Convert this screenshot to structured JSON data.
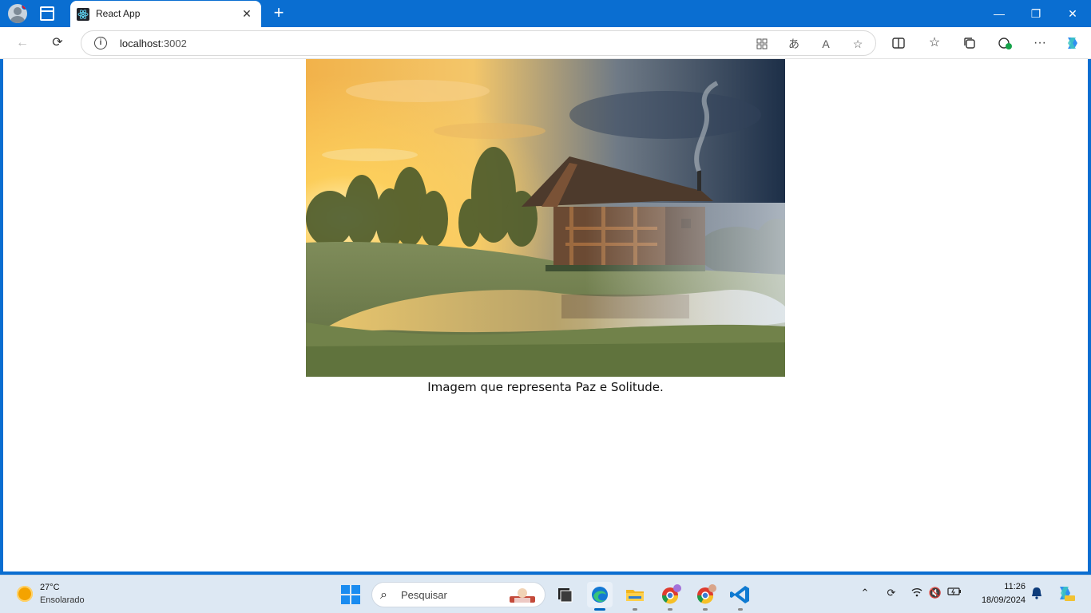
{
  "browser": {
    "tab_title": "React App",
    "tab_close": "✕",
    "new_tab": "+",
    "window_minimize": "—",
    "window_restore": "❐",
    "window_close": "✕",
    "nav_back": "←",
    "nav_refresh": "⟳",
    "url_host": "localhost",
    "url_port": ":3002",
    "url_icons": [
      "apps-icon",
      "translate-icon",
      "read-aloud-icon",
      "favorite-star-icon"
    ],
    "toolbar_icons": [
      "split-screen-icon",
      "favorites-icon",
      "collections-icon",
      "performance-icon",
      "more-icon",
      "copilot-icon"
    ]
  },
  "page": {
    "caption": "Imagem que representa Paz e Solitude."
  },
  "taskbar": {
    "weather_temp": "27°C",
    "weather_desc": "Ensolarado",
    "search_placeholder": "Pesquisar",
    "clock_time": "11:26",
    "clock_date": "18/09/2024",
    "apps": [
      "file-explorer-icon",
      "edge-icon",
      "folder-icon",
      "chrome-icon",
      "chrome-profile-icon",
      "vscode-icon"
    ],
    "tray_icons": [
      "chevron-up-icon",
      "sync-icon",
      "wifi-icon",
      "volume-muted-icon",
      "battery-icon",
      "bell-icon",
      "copilot-pre-icon"
    ],
    "accent": "#0067c0"
  },
  "colors": {
    "titlebar": "#0a6ed1",
    "edge_blue": "#0c59a4"
  }
}
